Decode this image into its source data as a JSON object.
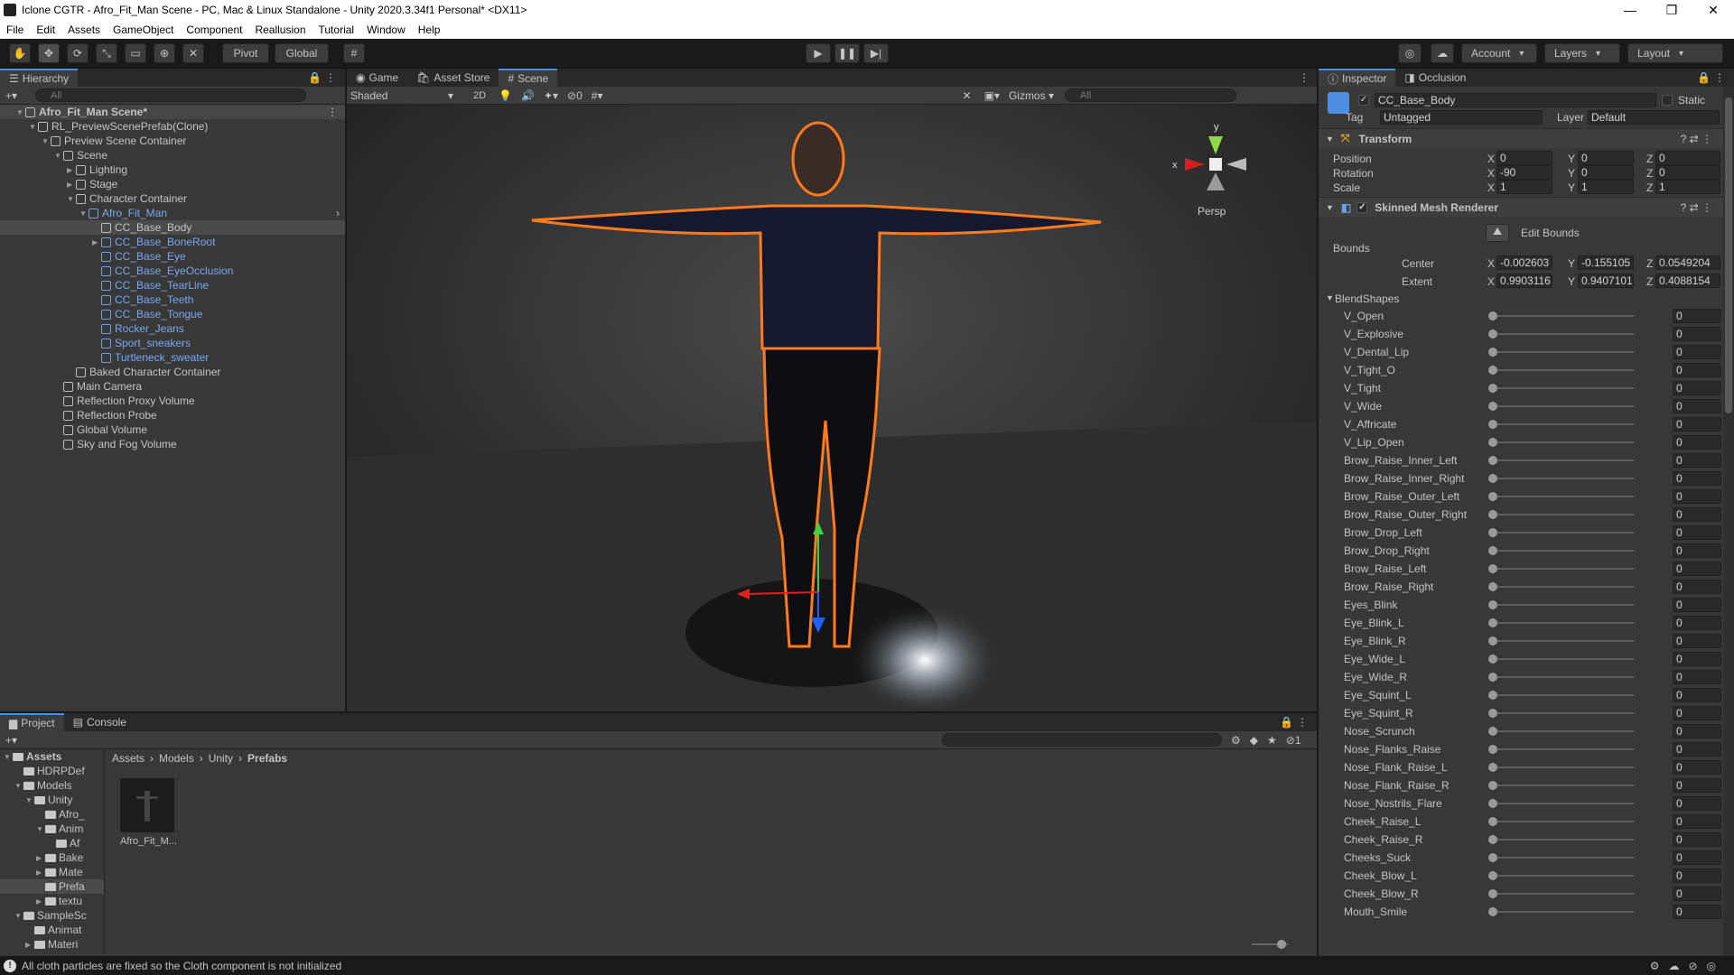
{
  "window": {
    "title": "Iclone CGTR - Afro_Fit_Man  Scene - PC, Mac & Linux Standalone - Unity 2020.3.34f1 Personal* <DX11>",
    "min": "—",
    "max": "❐",
    "close": "✕"
  },
  "menu": [
    "File",
    "Edit",
    "Assets",
    "GameObject",
    "Component",
    "Reallusion",
    "Tutorial",
    "Window",
    "Help"
  ],
  "toolbar": {
    "pivot": "Pivot",
    "global": "Global",
    "account": "Account",
    "layers": "Layers",
    "layout": "Layout"
  },
  "hierarchy": {
    "tab": "Hierarchy",
    "search": "All",
    "rows": [
      {
        "label": "Afro_Fit_Man  Scene*",
        "indent": 0,
        "arrow": "▼",
        "icon": "scene",
        "scene": true
      },
      {
        "label": "RL_PreviewScenePrefab(Clone)",
        "indent": 1,
        "arrow": "▼",
        "icon": "cube"
      },
      {
        "label": "Preview Scene Container",
        "indent": 2,
        "arrow": "▼",
        "icon": "cube"
      },
      {
        "label": "Scene",
        "indent": 3,
        "arrow": "▼",
        "icon": "cube"
      },
      {
        "label": "Lighting",
        "indent": 4,
        "arrow": "▶",
        "icon": "cube"
      },
      {
        "label": "Stage",
        "indent": 4,
        "arrow": "▶",
        "icon": "cube"
      },
      {
        "label": "Character Container",
        "indent": 4,
        "arrow": "▼",
        "icon": "cube"
      },
      {
        "label": "Afro_Fit_Man",
        "indent": 5,
        "arrow": "▼",
        "icon": "prefab",
        "prefab": true,
        "more": true
      },
      {
        "label": "CC_Base_Body",
        "indent": 6,
        "arrow": "",
        "icon": "cube",
        "selected": true
      },
      {
        "label": "CC_Base_BoneRoot",
        "indent": 6,
        "arrow": "▶",
        "icon": "cube",
        "prefab": true
      },
      {
        "label": "CC_Base_Eye",
        "indent": 6,
        "arrow": "",
        "icon": "cube",
        "prefab": true
      },
      {
        "label": "CC_Base_EyeOcclusion",
        "indent": 6,
        "arrow": "",
        "icon": "cube",
        "prefab": true
      },
      {
        "label": "CC_Base_TearLine",
        "indent": 6,
        "arrow": "",
        "icon": "cube",
        "prefab": true
      },
      {
        "label": "CC_Base_Teeth",
        "indent": 6,
        "arrow": "",
        "icon": "cube",
        "prefab": true
      },
      {
        "label": "CC_Base_Tongue",
        "indent": 6,
        "arrow": "",
        "icon": "cube",
        "prefab": true
      },
      {
        "label": "Rocker_Jeans",
        "indent": 6,
        "arrow": "",
        "icon": "cube",
        "prefab": true
      },
      {
        "label": "Sport_sneakers",
        "indent": 6,
        "arrow": "",
        "icon": "cube",
        "prefab": true
      },
      {
        "label": "Turtleneck_sweater",
        "indent": 6,
        "arrow": "",
        "icon": "cube",
        "prefab": true
      },
      {
        "label": "Baked Character Container",
        "indent": 4,
        "arrow": "",
        "icon": "cube"
      },
      {
        "label": "Main Camera",
        "indent": 3,
        "arrow": "",
        "icon": "cube"
      },
      {
        "label": "Reflection Proxy Volume",
        "indent": 3,
        "arrow": "",
        "icon": "cube"
      },
      {
        "label": "Reflection Probe",
        "indent": 3,
        "arrow": "",
        "icon": "cube"
      },
      {
        "label": "Global Volume",
        "indent": 3,
        "arrow": "",
        "icon": "cube"
      },
      {
        "label": "Sky and Fog Volume",
        "indent": 3,
        "arrow": "",
        "icon": "cube"
      }
    ]
  },
  "sceneView": {
    "tabs": [
      "Game",
      "Asset Store",
      "Scene"
    ],
    "shading": "Shaded",
    "mode2d": "2D",
    "hidden": "0",
    "gizmos": "Gizmos",
    "search": "All",
    "persp": "Persp",
    "axisX": "x",
    "axisY": "y"
  },
  "project": {
    "tabs": [
      "Project",
      "Console"
    ],
    "breadcrumb": [
      "Assets",
      "Models",
      "Unity",
      "Prefabs"
    ],
    "hiddenCount": "1",
    "tree": [
      {
        "label": "Assets",
        "indent": 0,
        "arrow": "▼",
        "bold": true
      },
      {
        "label": "HDRPDef",
        "indent": 1,
        "arrow": ""
      },
      {
        "label": "Models",
        "indent": 1,
        "arrow": "▼"
      },
      {
        "label": "Unity",
        "indent": 2,
        "arrow": "▼"
      },
      {
        "label": "Afro_",
        "indent": 3,
        "arrow": ""
      },
      {
        "label": "Anim",
        "indent": 3,
        "arrow": "▼"
      },
      {
        "label": "Af",
        "indent": 4,
        "arrow": ""
      },
      {
        "label": "Bake",
        "indent": 3,
        "arrow": "▶"
      },
      {
        "label": "Mate",
        "indent": 3,
        "arrow": "▶"
      },
      {
        "label": "Prefa",
        "indent": 3,
        "arrow": "",
        "selected": true
      },
      {
        "label": "textu",
        "indent": 3,
        "arrow": "▶"
      },
      {
        "label": "SampleSc",
        "indent": 1,
        "arrow": "▼"
      },
      {
        "label": "Animat",
        "indent": 2,
        "arrow": ""
      },
      {
        "label": "Materi",
        "indent": 2,
        "arrow": "▶"
      }
    ],
    "asset": "Afro_Fit_M..."
  },
  "inspector": {
    "tabs": [
      "Inspector",
      "Occlusion"
    ],
    "objectName": "CC_Base_Body",
    "static": "Static",
    "tagLabel": "Tag",
    "tag": "Untagged",
    "layerLabel": "Layer",
    "layer": "Default",
    "transform": {
      "title": "Transform",
      "rows": [
        {
          "label": "Position",
          "x": "0",
          "y": "0",
          "z": "0"
        },
        {
          "label": "Rotation",
          "x": "-90",
          "y": "0",
          "z": "0"
        },
        {
          "label": "Scale",
          "x": "1",
          "y": "1",
          "z": "1"
        }
      ]
    },
    "smr": {
      "title": "Skinned Mesh Renderer",
      "editBounds": "Edit Bounds",
      "bounds": "Bounds",
      "center": {
        "label": "Center",
        "x": "-0.002603",
        "y": "-0.155105",
        "z": "0.0549204"
      },
      "extent": {
        "label": "Extent",
        "x": "0.9903116",
        "y": "0.9407101",
        "z": "0.4088154"
      }
    },
    "blendTitle": "BlendShapes",
    "blendshapes": [
      "V_Open",
      "V_Explosive",
      "V_Dental_Lip",
      "V_Tight_O",
      "V_Tight",
      "V_Wide",
      "V_Affricate",
      "V_Lip_Open",
      "Brow_Raise_Inner_Left",
      "Brow_Raise_Inner_Right",
      "Brow_Raise_Outer_Left",
      "Brow_Raise_Outer_Right",
      "Brow_Drop_Left",
      "Brow_Drop_Right",
      "Brow_Raise_Left",
      "Brow_Raise_Right",
      "Eyes_Blink",
      "Eye_Blink_L",
      "Eye_Blink_R",
      "Eye_Wide_L",
      "Eye_Wide_R",
      "Eye_Squint_L",
      "Eye_Squint_R",
      "Nose_Scrunch",
      "Nose_Flanks_Raise",
      "Nose_Flank_Raise_L",
      "Nose_Flank_Raise_R",
      "Nose_Nostrils_Flare",
      "Cheek_Raise_L",
      "Cheek_Raise_R",
      "Cheeks_Suck",
      "Cheek_Blow_L",
      "Cheek_Blow_R",
      "Mouth_Smile"
    ],
    "blendValue": "0",
    "axes": {
      "x": "X",
      "y": "Y",
      "z": "Z"
    }
  },
  "status": {
    "message": "All cloth particles are fixed so the Cloth component is not initialized"
  }
}
